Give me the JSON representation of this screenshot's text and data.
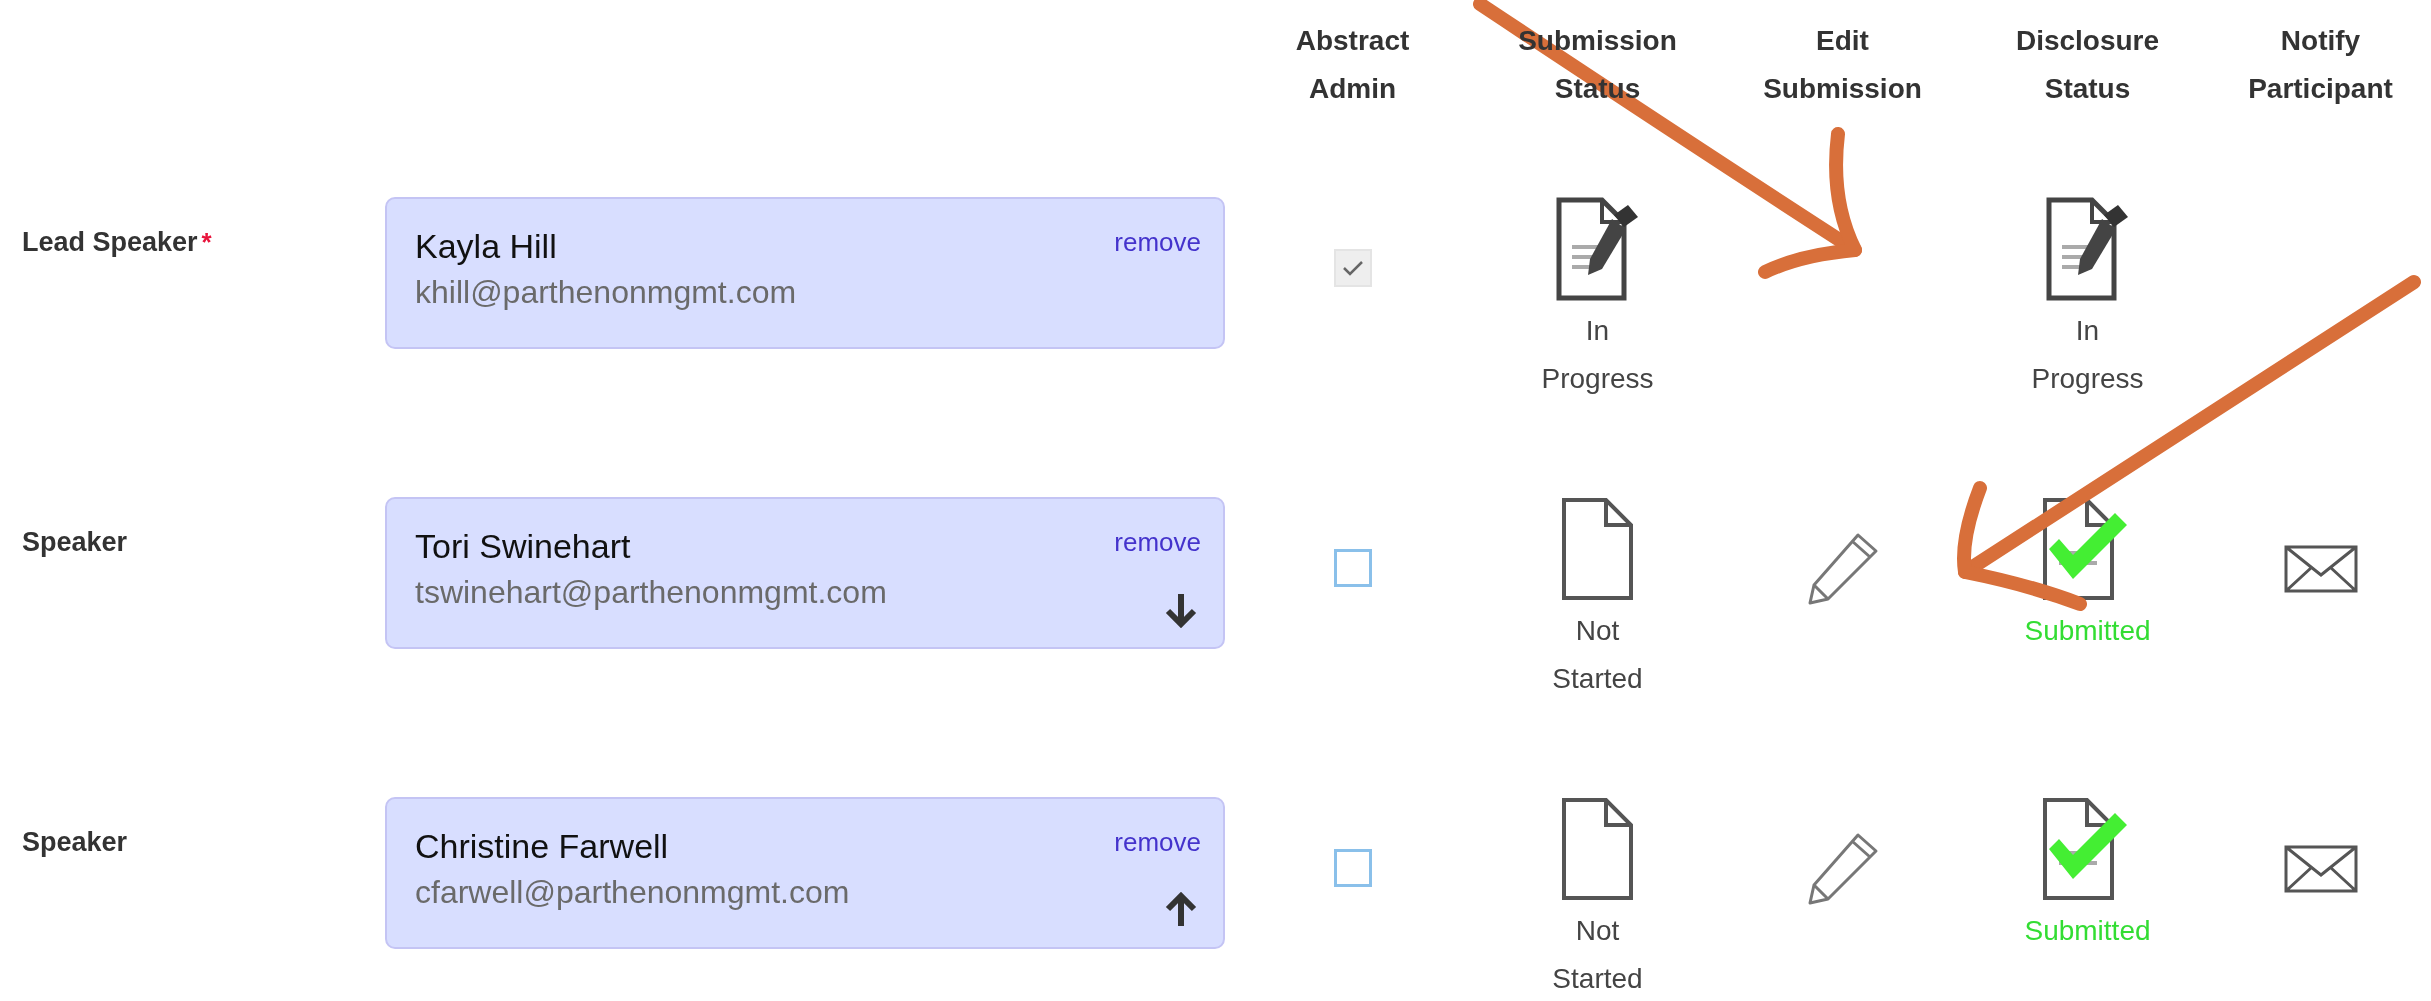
{
  "columns": [
    "Abstract Admin",
    "Submission Status",
    "Edit Submission",
    "Disclosure Status",
    "Notify Participant"
  ],
  "speakers": [
    {
      "role": "Lead Speaker",
      "required_mark": "*",
      "name": "Kayla Hill",
      "email": "khill@parthenonmgmt.com",
      "remove": "remove",
      "move_down": false,
      "move_up": false,
      "abstract_admin": {
        "checked": true,
        "disabled": true
      },
      "submission_status": {
        "kind": "in_progress",
        "label": "In Progress"
      },
      "editable": false,
      "disclosure_status": {
        "kind": "in_progress",
        "label": "In Progress"
      },
      "notify": false
    },
    {
      "role": "Speaker",
      "name": "Tori Swinehart",
      "email": "tswinehart@parthenonmgmt.com",
      "remove": "remove",
      "move_down": true,
      "move_up": false,
      "abstract_admin": {
        "checked": false,
        "disabled": false
      },
      "submission_status": {
        "kind": "not_started",
        "label": "Not Started"
      },
      "editable": true,
      "disclosure_status": {
        "kind": "submitted",
        "label": "Submitted"
      },
      "notify": true
    },
    {
      "role": "Speaker",
      "name": "Christine Farwell",
      "email": "cfarwell@parthenonmgmt.com",
      "remove": "remove",
      "move_down": false,
      "move_up": true,
      "abstract_admin": {
        "checked": false,
        "disabled": false
      },
      "submission_status": {
        "kind": "not_started",
        "label": "Not Started"
      },
      "editable": true,
      "disclosure_status": {
        "kind": "submitted",
        "label": "Submitted"
      },
      "notify": true
    }
  ]
}
